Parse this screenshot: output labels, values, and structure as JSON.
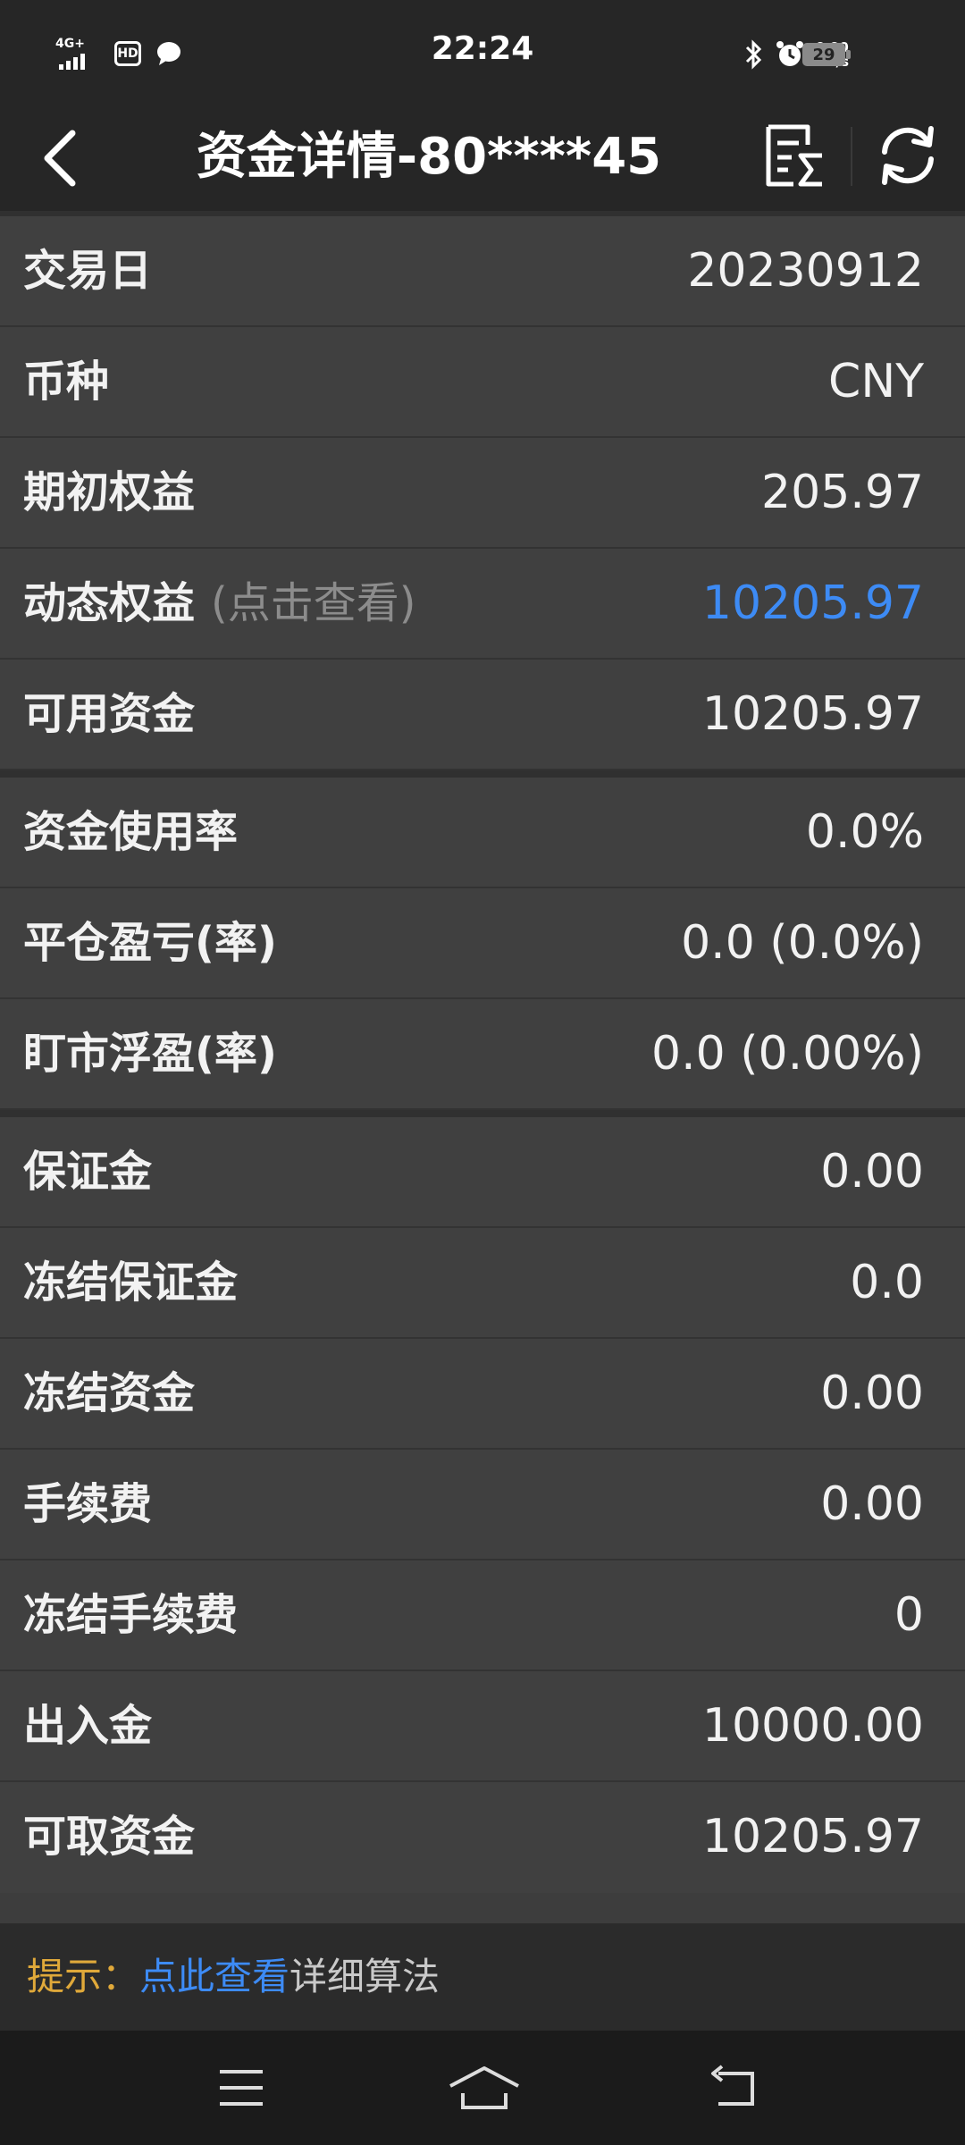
{
  "status_bar": {
    "network": "4G+",
    "hd_badge": "HD",
    "time": "22:24",
    "speed_value": "0.90",
    "speed_unit": "KB/s",
    "battery": "29"
  },
  "header": {
    "title": "资金详情-80****45"
  },
  "rows": [
    {
      "label": "交易日",
      "value": "20230912"
    },
    {
      "label": "币种",
      "value": "CNY"
    },
    {
      "label": "期初权益",
      "value": "205.97"
    },
    {
      "label": "动态权益",
      "hint": "(点击查看)",
      "value": "10205.97"
    },
    {
      "label": "可用资金",
      "value": "10205.97"
    },
    {
      "label": "资金使用率",
      "value": "0.0%"
    },
    {
      "label": "平仓盈亏(率)",
      "value": "0.0 (0.0%)"
    },
    {
      "label": "盯市浮盈(率)",
      "value": "0.0 (0.00%)"
    },
    {
      "label": "保证金",
      "value": "0.00"
    },
    {
      "label": "冻结保证金",
      "value": "0.0"
    },
    {
      "label": "冻结资金",
      "value": "0.00"
    },
    {
      "label": "手续费",
      "value": "0.00"
    },
    {
      "label": "冻结手续费",
      "value": "0"
    },
    {
      "label": "出入金",
      "value": "10000.00"
    },
    {
      "label": "可取资金",
      "value": "10205.97"
    }
  ],
  "tip": {
    "prefix": "提示：",
    "link": "点此查看",
    "rest": "详细算法"
  },
  "colors": {
    "accent_blue": "#3d8bf5",
    "tip_orange": "#e0a93a",
    "background": "#3d3d3d"
  }
}
